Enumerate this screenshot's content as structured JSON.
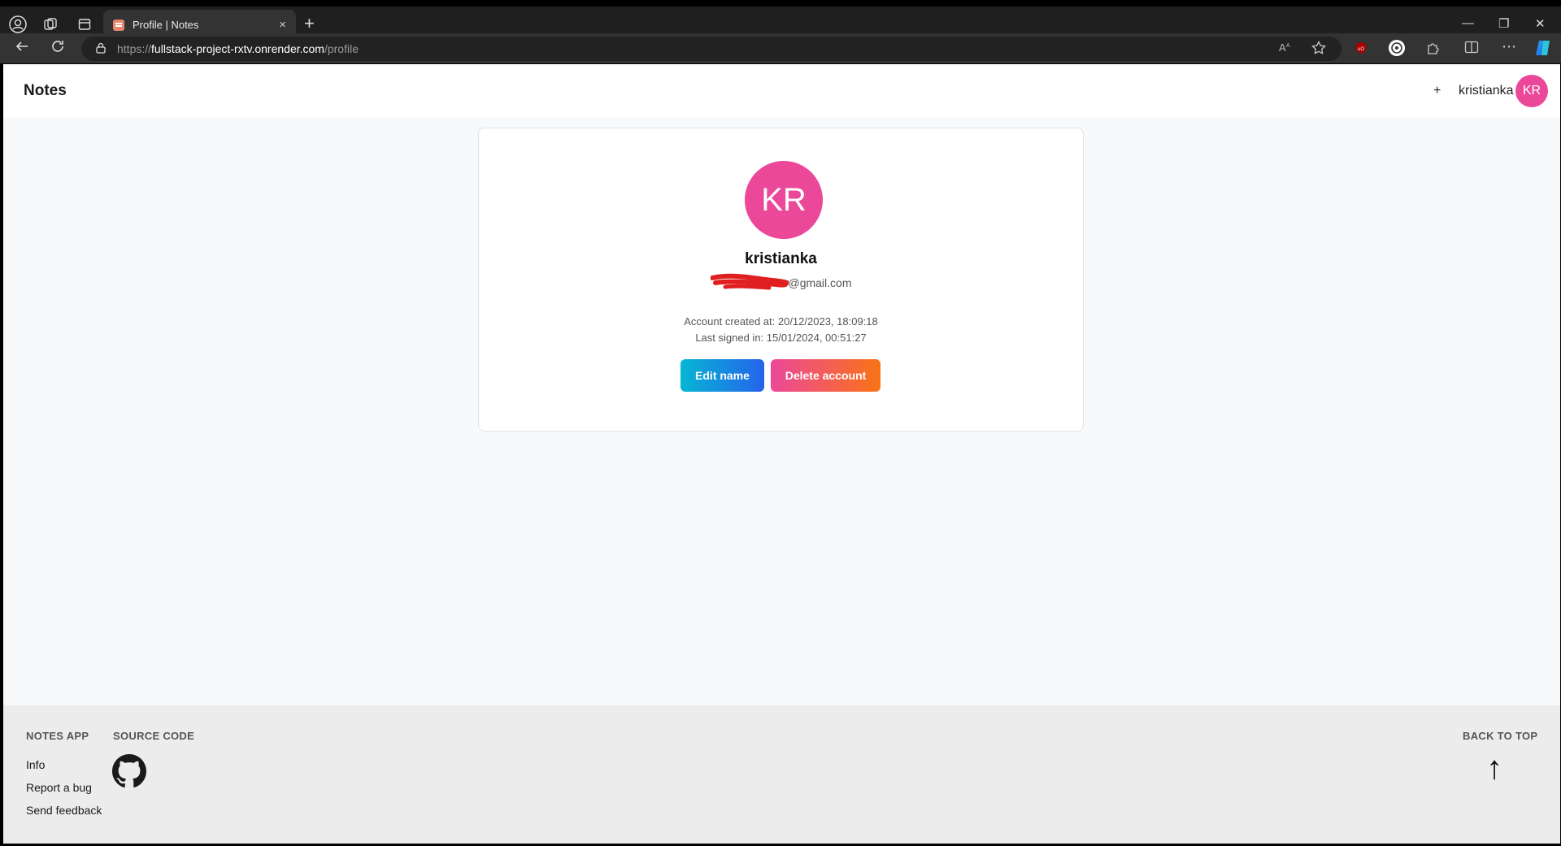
{
  "browser": {
    "tab_title": "Profile | Notes",
    "url_proto": "https://",
    "url_host": "fullstack-project-rxtv.onrender.com",
    "url_path": "/profile",
    "close_tab": "×",
    "new_tab": "+",
    "window_controls": {
      "minimize": "—",
      "restore": "❐",
      "close": "✕"
    }
  },
  "header": {
    "brand": "Notes",
    "add": "+",
    "username": "kristianka",
    "avatar_initials": "KR",
    "avatar_color": "#ec4899"
  },
  "profile": {
    "initials": "KR",
    "name": "kristianka",
    "email_visible": "@gmail.com",
    "created": "Account created at: 20/12/2023, 18:09:18",
    "last_signed": "Last signed in: 15/01/2024, 00:51:27",
    "edit_button": "Edit name",
    "delete_button": "Delete account"
  },
  "footer": {
    "notes_app_heading": "NOTES APP",
    "source_code_heading": "SOURCE CODE",
    "back_to_top_heading": "BACK TO TOP",
    "links": [
      "Info",
      "Report a bug",
      "Send feedback"
    ],
    "back_to_top_arrow": "↑"
  }
}
